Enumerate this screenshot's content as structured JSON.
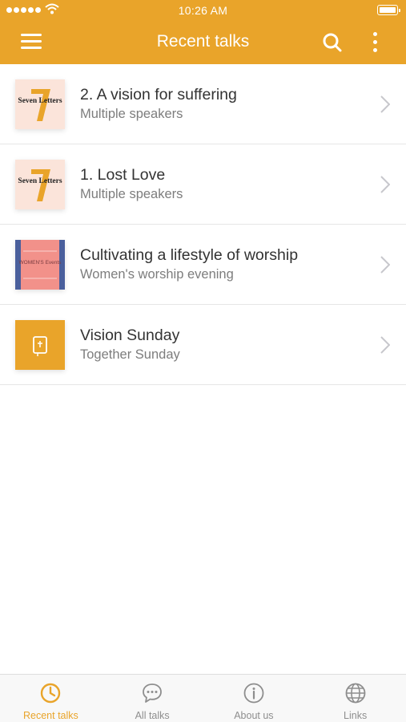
{
  "status_bar": {
    "time": "10:26 AM"
  },
  "nav": {
    "title": "Recent talks"
  },
  "icons": {
    "menu": "hamburger-icon",
    "search": "search-icon",
    "more": "more-vertical-icon",
    "chevron": "chevron-right-icon"
  },
  "talks": [
    {
      "title": "2. A vision for suffering",
      "subtitle": "Multiple speakers",
      "thumb_text": "Seven Letters"
    },
    {
      "title": "1. Lost Love",
      "subtitle": "Multiple speakers",
      "thumb_text": "Seven Letters"
    },
    {
      "title": "Cultivating a lifestyle of worship",
      "subtitle": "Women's worship evening",
      "thumb_text": "WOMEN'S Events"
    },
    {
      "title": "Vision Sunday",
      "subtitle": "Together Sunday",
      "thumb_text": ""
    }
  ],
  "tabs": [
    {
      "label": "Recent talks",
      "icon": "clock-icon",
      "active": true
    },
    {
      "label": "All talks",
      "icon": "speech-bubble-icon",
      "active": false
    },
    {
      "label": "About us",
      "icon": "info-icon",
      "active": false
    },
    {
      "label": "Links",
      "icon": "globe-icon",
      "active": false
    }
  ],
  "colors": {
    "accent": "#E9A42A",
    "title_text": "#333333",
    "subtitle_text": "#7D7D7D",
    "tab_inactive": "#8E8E8E"
  }
}
